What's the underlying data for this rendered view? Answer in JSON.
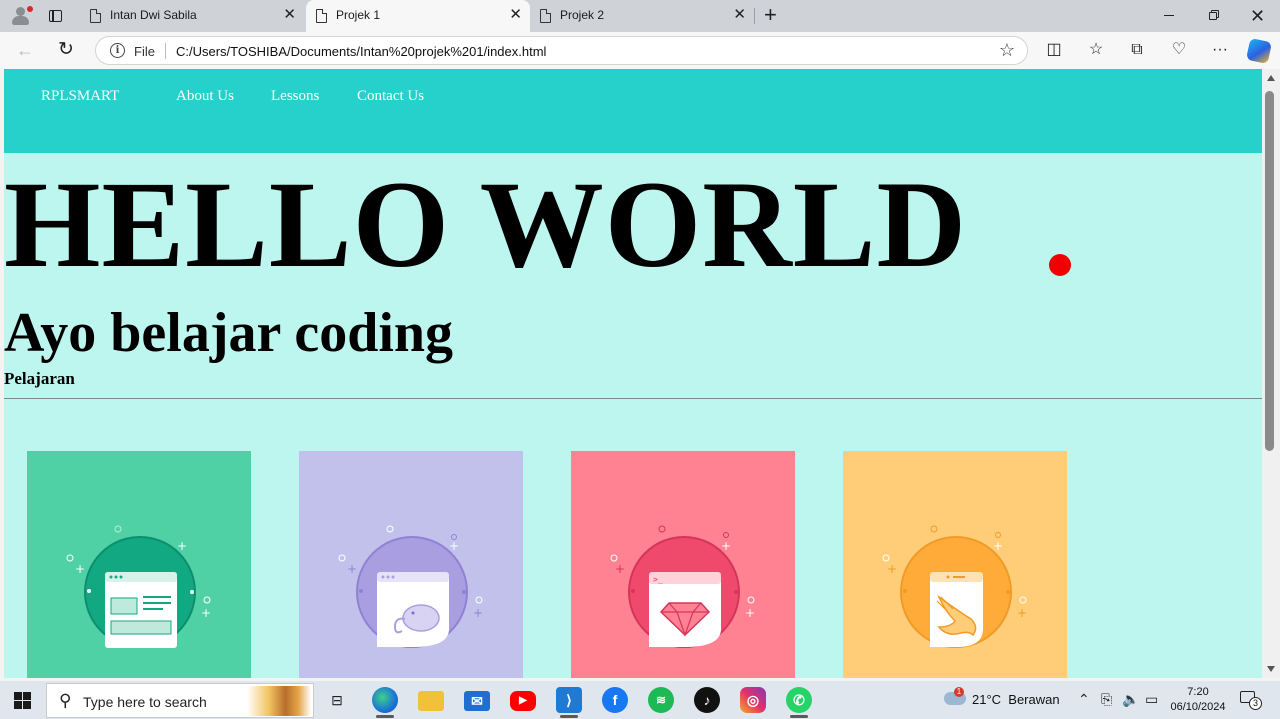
{
  "browser": {
    "tabs": [
      {
        "title": "Intan Dwi Sabila",
        "active": false
      },
      {
        "title": "Projek 1",
        "active": true
      },
      {
        "title": "Projek 2",
        "active": false
      }
    ],
    "new_tab_symbol": "+",
    "close_symbol": "✕",
    "address": {
      "scheme_label": "File",
      "url": "C:/Users/TOSHIBA/Documents/Intan%20projek%201/index.html"
    }
  },
  "page": {
    "colors": {
      "navbar": "#26d0cb",
      "background": "#bdf5ef",
      "dot": "#f00000"
    },
    "nav": {
      "brand": "RPLSMART",
      "links": [
        "About Us",
        "Lessons",
        "Contact Us"
      ]
    },
    "hero_title": "HELLO WORLD",
    "subtitle": "Ayo belajar coding",
    "section_label": "Pelajaran",
    "cards": [
      {
        "color": "#4fd1a5",
        "accent": "#12a882",
        "icon": "web-page-icon"
      },
      {
        "color": "#c2c1ec",
        "accent": "#a99ee0",
        "icon": "php-elephant-icon"
      },
      {
        "color": "#ff8293",
        "accent": "#ef4a6b",
        "icon": "ruby-gem-icon"
      },
      {
        "color": "#ffcd78",
        "accent": "#ffab3a",
        "icon": "swift-icon"
      }
    ]
  },
  "taskbar": {
    "search_placeholder": "Type here to search",
    "apps": [
      "task-view-icon",
      "edge-icon",
      "file-explorer-icon",
      "mail-icon",
      "youtube-icon",
      "vscode-icon",
      "facebook-icon",
      "spotify-icon",
      "tiktok-icon",
      "instagram-icon",
      "whatsapp-icon"
    ],
    "weather": {
      "badge": "1",
      "temp": "21°C",
      "condition": "Berawan"
    },
    "time": "7:20",
    "date": "06/10/2024",
    "notification_count": "3"
  }
}
